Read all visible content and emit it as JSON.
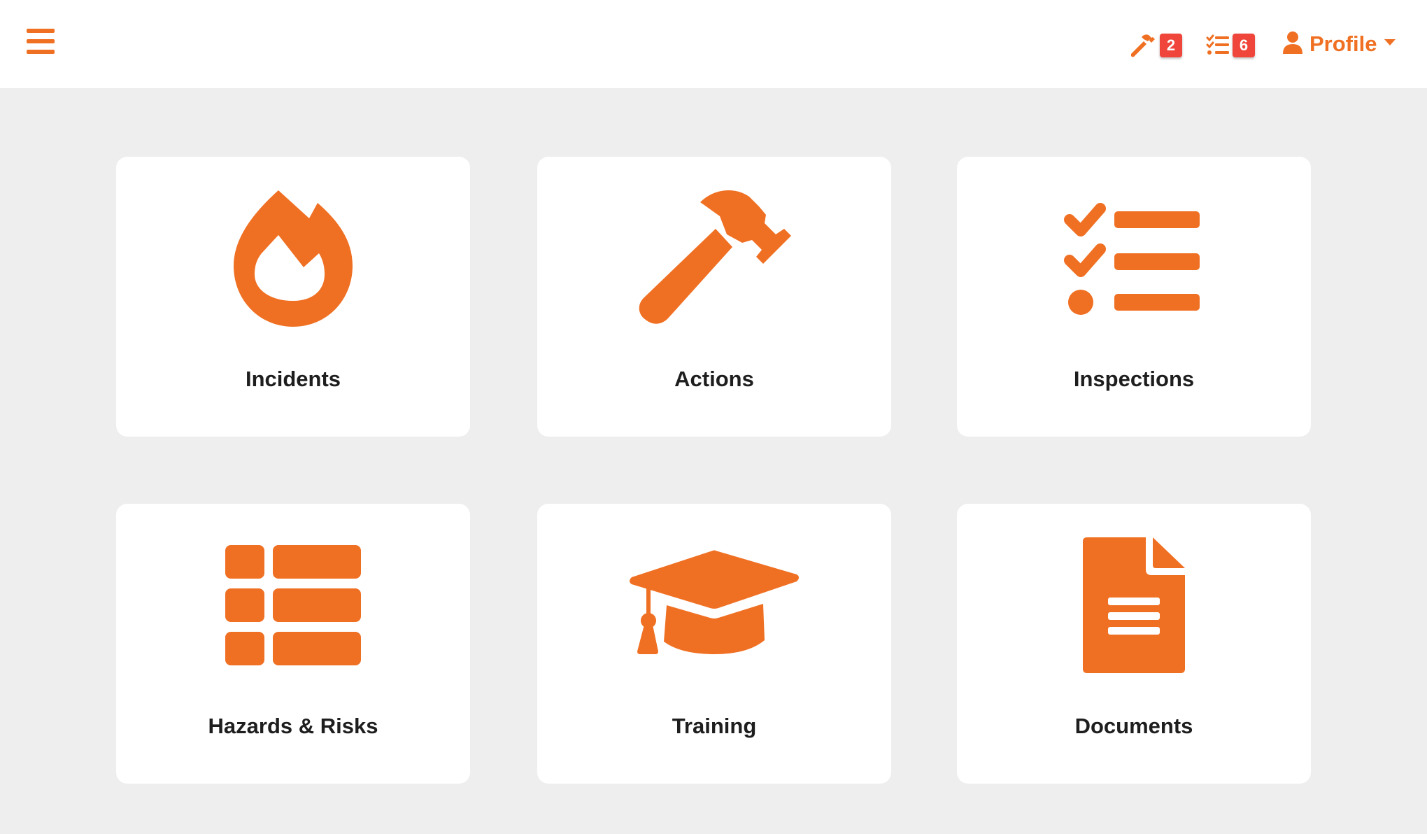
{
  "theme": {
    "accent": "#f07023",
    "badge": "#f0453a",
    "background": "#eeeeee",
    "card": "#ffffff",
    "text": "#1e1e1e"
  },
  "header": {
    "menu_icon": "hamburger-menu-icon",
    "actions_icon": "hammer-icon",
    "actions_count": "2",
    "inspections_icon": "checklist-icon",
    "inspections_count": "6",
    "profile_icon": "user-icon",
    "profile_label": "Profile",
    "profile_caret_icon": "caret-down-icon"
  },
  "tiles": [
    {
      "label": "Incidents",
      "icon": "fire-icon"
    },
    {
      "label": "Actions",
      "icon": "hammer-icon"
    },
    {
      "label": "Inspections",
      "icon": "checklist-icon"
    },
    {
      "label": "Hazards & Risks",
      "icon": "table-list-icon"
    },
    {
      "label": "Training",
      "icon": "graduation-cap-icon"
    },
    {
      "label": "Documents",
      "icon": "document-icon"
    }
  ]
}
